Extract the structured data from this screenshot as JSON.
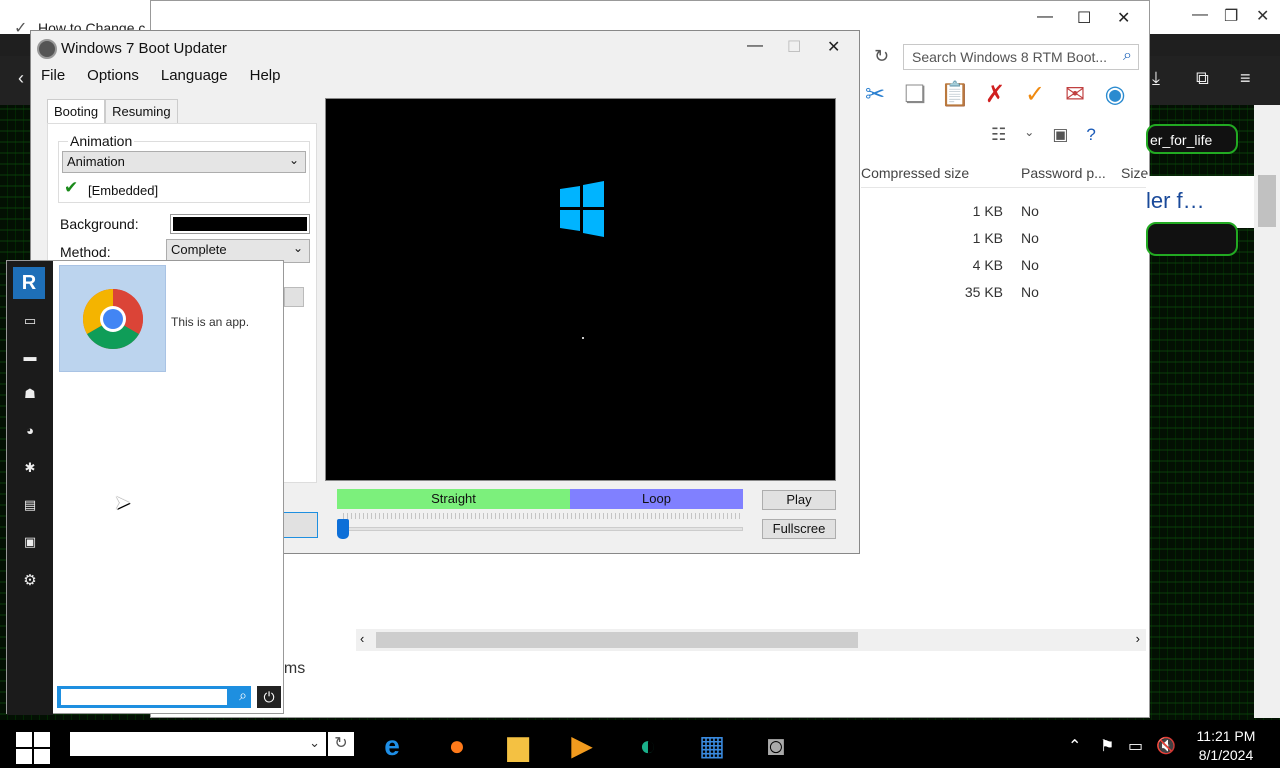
{
  "browser": {
    "tab_title": "How to Change c",
    "zip_search_placeholder": "Search Windows 8 RTM Boot...",
    "highlight_user": "er_for_life",
    "highlight_heading": "ler f…"
  },
  "zip": {
    "columns": [
      "Compressed size",
      "Password p...",
      "Size"
    ],
    "rows": [
      {
        "compressed": "1 KB",
        "password": "No"
      },
      {
        "compressed": "1 KB",
        "password": "No"
      },
      {
        "compressed": "4 KB",
        "password": "No"
      },
      {
        "compressed": "35 KB",
        "password": "No"
      }
    ],
    "status": "ems"
  },
  "boot": {
    "title": "Windows 7 Boot Updater",
    "menu": [
      "File",
      "Options",
      "Language",
      "Help"
    ],
    "tabs": [
      "Booting",
      "Resuming"
    ],
    "animation_group": "Animation",
    "animation_value": "Animation",
    "embedded_label": "[Embedded]",
    "background_label": "Background:",
    "background_color": "#000000",
    "method_label": "Method:",
    "method_value": "Complete",
    "segment_straight": "Straight",
    "segment_loop": "Loop",
    "play_label": "Play",
    "fullscreen_label": "Fullscree",
    "colors": {
      "straight": "#7cf07c",
      "loop": "#8080ff",
      "logo": "#00b4ff"
    }
  },
  "launcher": {
    "app_description": "This is an app.",
    "search_value": ""
  },
  "taskbar": {
    "time": "11:21 PM",
    "date": "8/1/2024"
  }
}
